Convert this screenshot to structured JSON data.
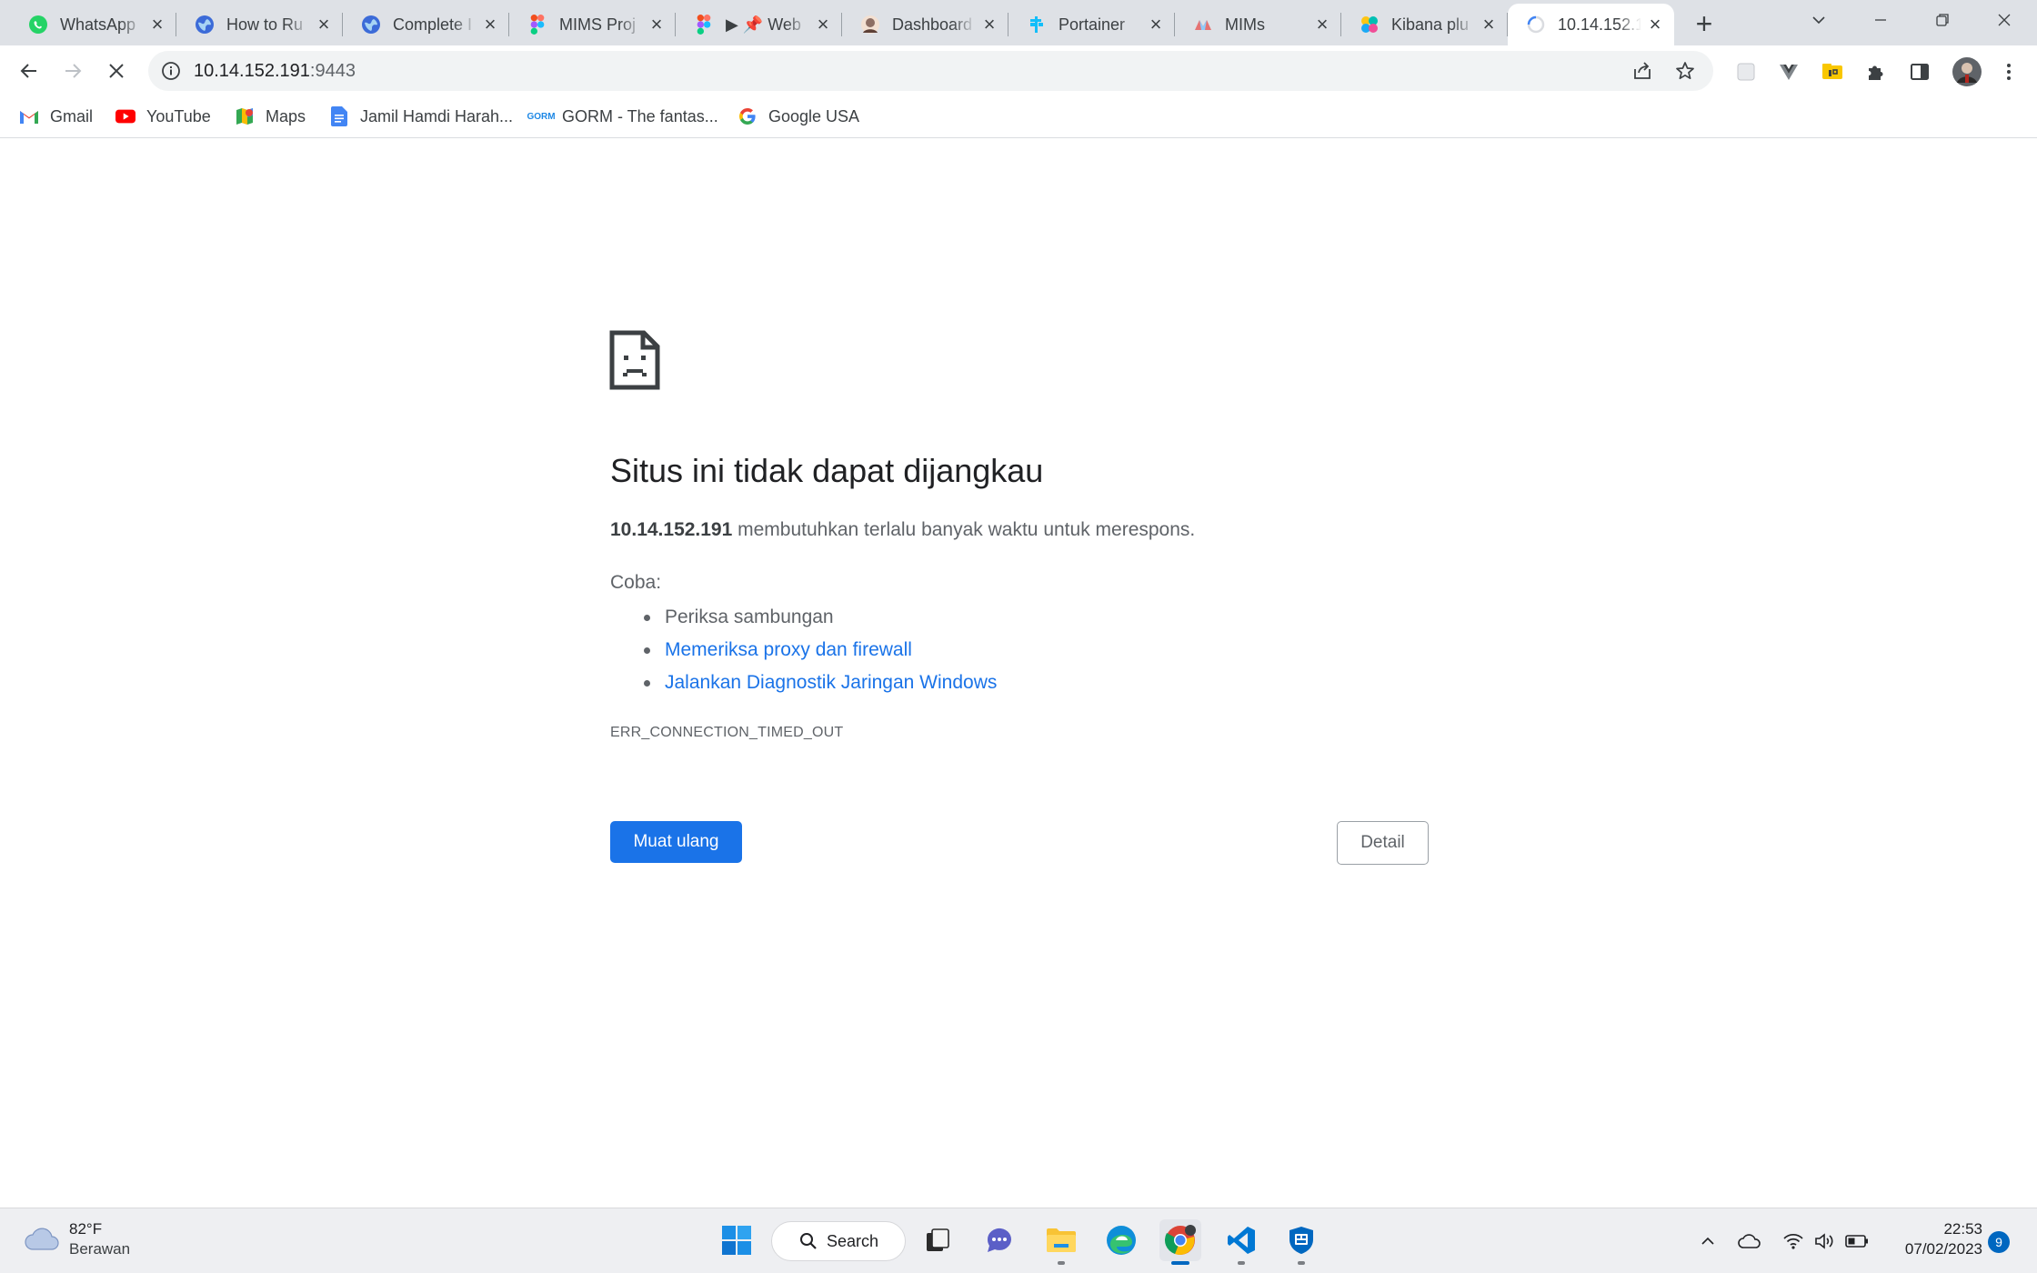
{
  "tabs": [
    {
      "title": "WhatsApp",
      "icon": "whatsapp-icon",
      "color": "#25d366"
    },
    {
      "title": "How to Ru",
      "icon": "globe-icon",
      "color": "#3c6bd8"
    },
    {
      "title": "Complete I",
      "icon": "globe-icon",
      "color": "#3c6bd8"
    },
    {
      "title": "MIMS Proj",
      "icon": "figma-icon",
      "color": "#f24e1e"
    },
    {
      "title": "▶ 📌 Web",
      "icon": "figma-icon",
      "color": "#f24e1e"
    },
    {
      "title": "Dashboard",
      "icon": "avatar-icon",
      "color": "#8d6e63"
    },
    {
      "title": "Portainer",
      "icon": "portainer-icon",
      "color": "#13bef9"
    },
    {
      "title": "MIMs",
      "icon": "mims-icon",
      "color": "#e57373"
    },
    {
      "title": "Kibana plu",
      "icon": "kibana-icon",
      "color": "#f04e98"
    },
    {
      "title": "10.14.152.1",
      "icon": "loading-spinner-icon",
      "color": "#4285f4",
      "active": true
    }
  ],
  "toolbar": {
    "url_host": "10.14.152.191",
    "url_port": ":9443"
  },
  "bookmarks": [
    {
      "label": "Gmail",
      "icon": "gmail-icon"
    },
    {
      "label": "YouTube",
      "icon": "youtube-icon"
    },
    {
      "label": "Maps",
      "icon": "maps-icon"
    },
    {
      "label": "Jamil Hamdi Harah...",
      "icon": "docs-icon"
    },
    {
      "label": "GORM - The fantas...",
      "icon": "gorm-icon"
    },
    {
      "label": "Google USA",
      "icon": "google-icon"
    }
  ],
  "error": {
    "title": "Situs ini tidak dapat dijangkau",
    "host": "10.14.152.191",
    "message": " membutuhkan terlalu banyak waktu untuk merespons.",
    "try_label": "Coba:",
    "suggestions": [
      {
        "text": "Periksa sambungan",
        "link": false
      },
      {
        "text": "Memeriksa proxy dan firewall",
        "link": true
      },
      {
        "text": "Jalankan Diagnostik Jaringan Windows",
        "link": true
      }
    ],
    "code": "ERR_CONNECTION_TIMED_OUT",
    "reload_label": "Muat ulang",
    "detail_label": "Detail"
  },
  "taskbar": {
    "temperature": "82°F",
    "weather": "Berawan",
    "search_label": "Search",
    "time": "22:53",
    "date": "07/02/2023",
    "notifications": "9"
  },
  "colors": {
    "accent": "#1a73e8",
    "tabstrip": "#dee1e6",
    "taskbar": "#eeeff2"
  }
}
